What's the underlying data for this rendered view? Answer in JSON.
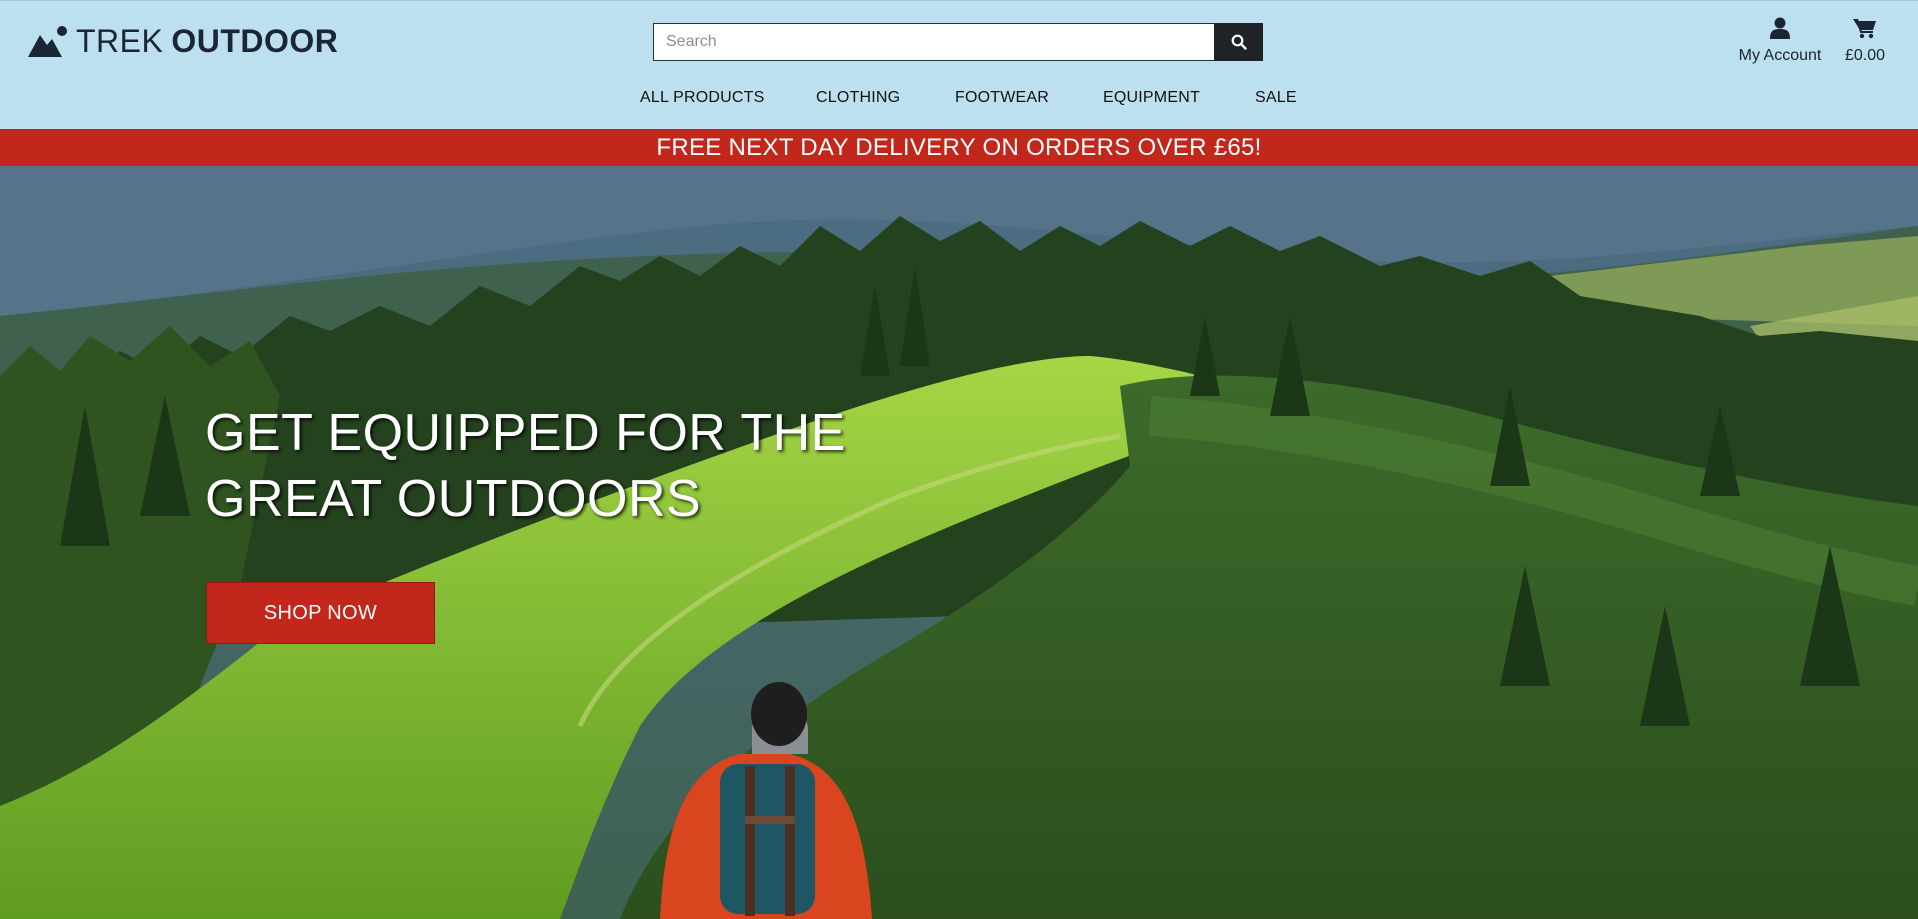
{
  "brand": {
    "word_light": "TREK",
    "word_bold": "OUTDOOR",
    "icon": "mountain-logo-icon"
  },
  "search": {
    "placeholder": "Search",
    "value": "",
    "button_icon": "search-icon"
  },
  "account": {
    "label": "My Account",
    "icon": "user-icon"
  },
  "cart": {
    "label": "£0.00",
    "icon": "cart-icon"
  },
  "nav": [
    {
      "label": "ALL PRODUCTS"
    },
    {
      "label": "CLOTHING"
    },
    {
      "label": "FOOTWEAR"
    },
    {
      "label": "EQUIPMENT"
    },
    {
      "label": "SALE"
    }
  ],
  "banner": {
    "text": "FREE NEXT DAY DELIVERY ON ORDERS OVER £65!"
  },
  "hero": {
    "title_line1": "GET EQUIPPED FOR THE",
    "title_line2": "GREAT OUTDOORS",
    "cta_label": "SHOP NOW",
    "image": "hiker-in-mountain-forest-landscape"
  },
  "colors": {
    "header_bg": "#bde0f0",
    "accent_red": "#c3261a",
    "dark": "#1f2328"
  }
}
